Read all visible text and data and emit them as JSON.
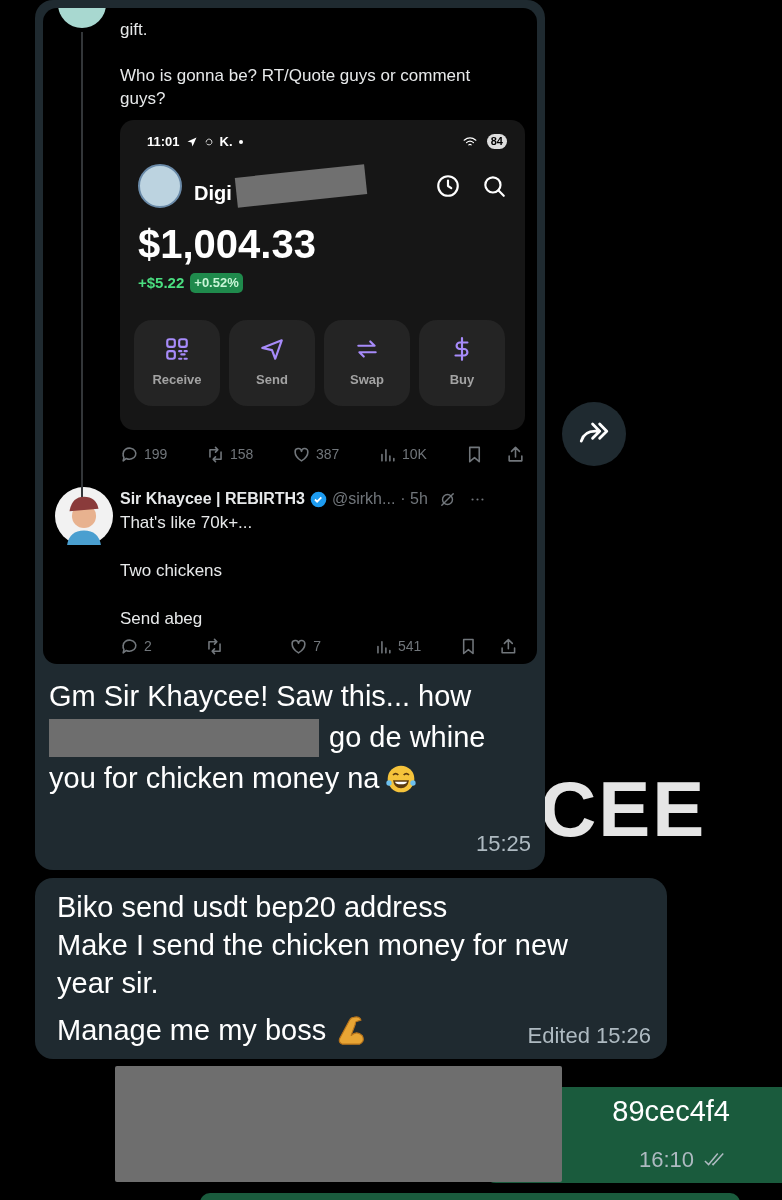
{
  "wallpaper_text": "CEE",
  "messages": [
    {
      "kind": "incoming_tweet",
      "tweet": {
        "text_lines": [
          "gift.",
          "Who is gonna be? RT/Quote guys or comment guys?"
        ],
        "wallet": {
          "status_time": "11:01",
          "status_letter": "K.",
          "battery": "84",
          "name": "Digi",
          "balance": "$1,004.33",
          "change": "+$5.22",
          "change_pct": "+0.52%",
          "actions": [
            {
              "kind": "qr",
              "label": "Receive"
            },
            {
              "kind": "send",
              "label": "Send"
            },
            {
              "kind": "swap",
              "label": "Swap"
            },
            {
              "kind": "buy",
              "label": "Buy"
            }
          ]
        },
        "stats": [
          {
            "kind": "reply",
            "count": "199"
          },
          {
            "kind": "repost",
            "count": "158"
          },
          {
            "kind": "like",
            "count": "387"
          },
          {
            "kind": "views",
            "count": "10K"
          }
        ],
        "reply": {
          "name": "Sir Khaycee | REBIRTH3",
          "handle": "@sirkh...",
          "age": "· 5h",
          "verified": true,
          "paragraphs": [
            "That's like 70k+...",
            "Two chickens",
            "Send abeg"
          ],
          "stats": [
            {
              "kind": "reply",
              "count": "2"
            },
            {
              "kind": "repost"
            },
            {
              "kind": "like",
              "count": "7"
            },
            {
              "kind": "views",
              "count": "541"
            }
          ]
        }
      },
      "lines": [
        "Gm Sir Khaycee! Saw this... how",
        "go de whine",
        "you for chicken money na"
      ],
      "time": "15:25"
    },
    {
      "kind": "incoming",
      "lines": [
        "Biko send usdt bep20 address",
        "Make I send the chicken money for new year sir.",
        "Manage me my boss"
      ],
      "edited": "Edited",
      "time": "15:26"
    },
    {
      "kind": "outgoing",
      "lines": [
        "89cec4f4"
      ],
      "time": "16:10",
      "read": false
    }
  ]
}
